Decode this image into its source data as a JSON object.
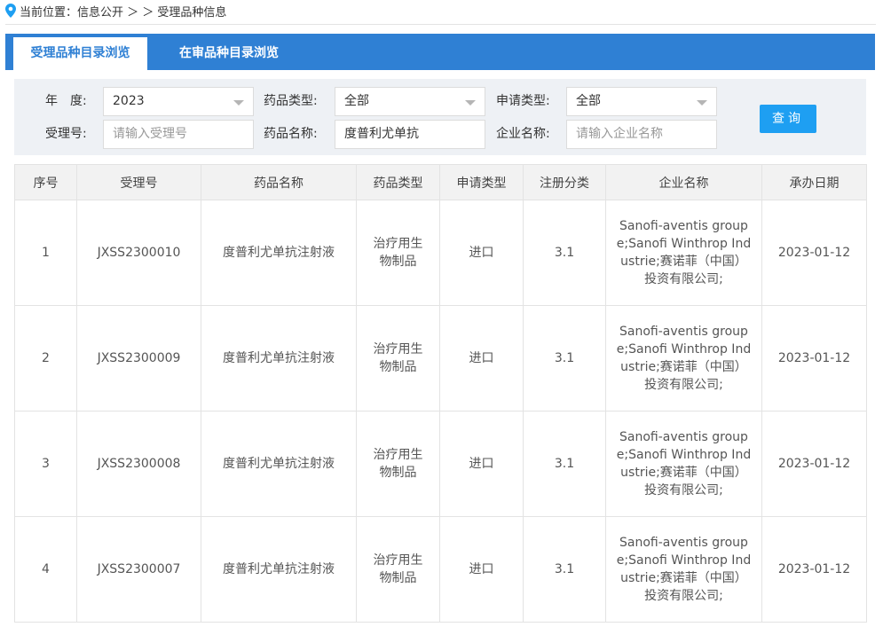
{
  "breadcrumb": {
    "text": "当前位置：信息公开 ＞ ＞ 受理品种信息"
  },
  "tabs": [
    {
      "label": "受理品种目录浏览"
    },
    {
      "label": "在审品种目录浏览"
    }
  ],
  "filter": {
    "year_label": "年　度:",
    "year_value": "2023",
    "drug_type_label": "药品类型:",
    "drug_type_value": "全部",
    "apply_type_label": "申请类型:",
    "apply_type_value": "全部",
    "accept_no_label": "受理号:",
    "accept_no_placeholder": "请输入受理号",
    "drug_name_label": "药品名称:",
    "drug_name_value": "度普利尤单抗",
    "company_label": "企业名称:",
    "company_placeholder": "请输入企业名称",
    "query_button": "查询"
  },
  "table": {
    "headers": [
      "序号",
      "受理号",
      "药品名称",
      "药品类型",
      "申请类型",
      "注册分类",
      "企业名称",
      "承办日期"
    ],
    "rows": [
      {
        "no": "1",
        "accept_no": "JXSS2300010",
        "drug_name": "度普利尤单抗注射液",
        "drug_type": "治疗用生物制品",
        "apply_type": "进口",
        "reg_class": "3.1",
        "company": "Sanofi-aventis groupe;Sanofi Winthrop Industrie;赛诺菲（中国）投资有限公司;",
        "date": "2023-01-12"
      },
      {
        "no": "2",
        "accept_no": "JXSS2300009",
        "drug_name": "度普利尤单抗注射液",
        "drug_type": "治疗用生物制品",
        "apply_type": "进口",
        "reg_class": "3.1",
        "company": "Sanofi-aventis groupe;Sanofi Winthrop Industrie;赛诺菲（中国）投资有限公司;",
        "date": "2023-01-12"
      },
      {
        "no": "3",
        "accept_no": "JXSS2300008",
        "drug_name": "度普利尤单抗注射液",
        "drug_type": "治疗用生物制品",
        "apply_type": "进口",
        "reg_class": "3.1",
        "company": "Sanofi-aventis groupe;Sanofi Winthrop Industrie;赛诺菲（中国）投资有限公司;",
        "date": "2023-01-12"
      },
      {
        "no": "4",
        "accept_no": "JXSS2300007",
        "drug_name": "度普利尤单抗注射液",
        "drug_type": "治疗用生物制品",
        "apply_type": "进口",
        "reg_class": "3.1",
        "company": "Sanofi-aventis groupe;Sanofi Winthrop Industrie;赛诺菲（中国）投资有限公司;",
        "date": "2023-01-12"
      }
    ]
  },
  "colors": {
    "accent": "#2f80d4",
    "button": "#1e9ff2",
    "filter_bg": "#eef1f5"
  },
  "icons": {
    "location": "location-pin-icon",
    "dropdown": "chevron-down-icon"
  }
}
